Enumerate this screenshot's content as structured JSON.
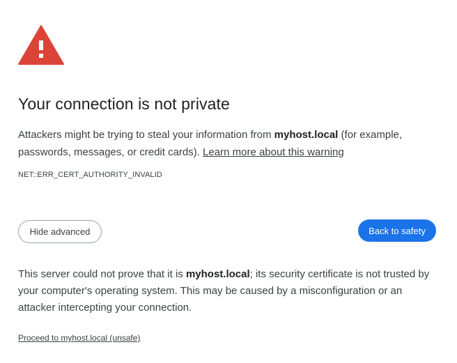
{
  "icon": "warning-triangle-icon",
  "colors": {
    "warning_red": "#db4437",
    "primary_blue": "#1a73e8",
    "text": "#3c4043",
    "heading": "#202124"
  },
  "title": "Your connection is not private",
  "explanation": {
    "before_host": "Attackers might be trying to steal your information from ",
    "host": "myhost.local",
    "after_host": " (for example, passwords, messages, or credit cards). ",
    "learn_more_link": "Learn more about this warning"
  },
  "error_code": "NET::ERR_CERT_AUTHORITY_INVALID",
  "buttons": {
    "hide_advanced": "Hide advanced",
    "back_to_safety": "Back to safety"
  },
  "details": {
    "before_host": "This server could not prove that it is ",
    "host": "myhost.local",
    "after_host": "; its security certificate is not trusted by your computer's operating system. This may be caused by a misconfiguration or an attacker intercepting your connection."
  },
  "proceed_link": "Proceed to myhost.local (unsafe)"
}
